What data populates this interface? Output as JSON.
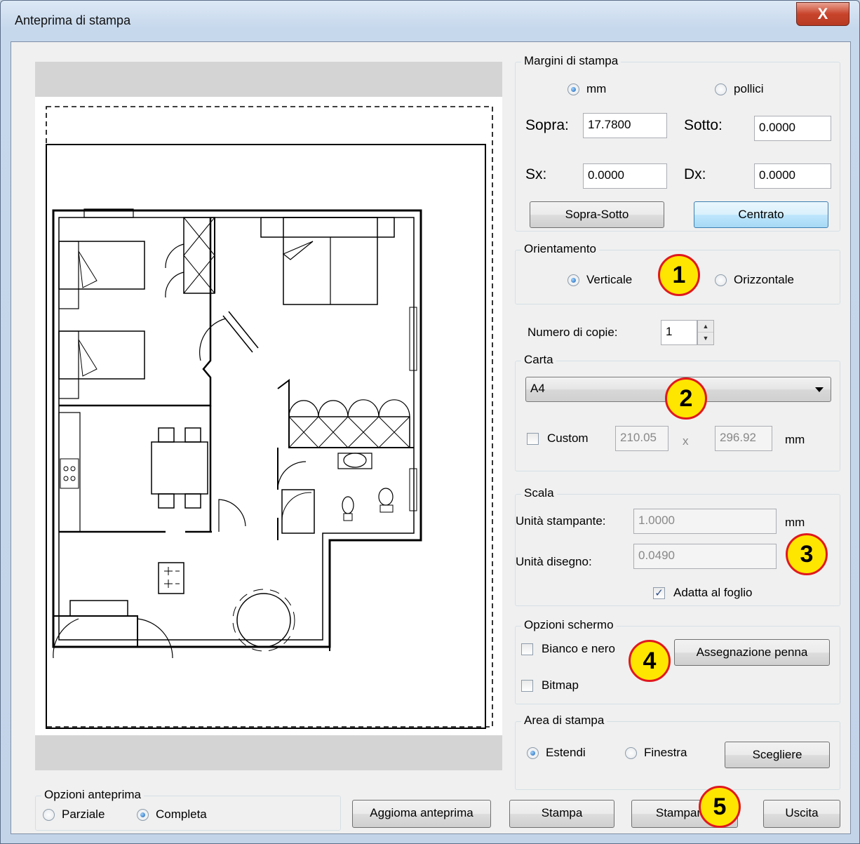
{
  "window": {
    "title": "Anteprima di stampa",
    "close_glyph": "X"
  },
  "margins": {
    "group": "Margini di stampa",
    "unit_mm": "mm",
    "unit_in": "pollici",
    "top_label": "Sopra:",
    "top_value": "17.7800",
    "bottom_label": "Sotto:",
    "bottom_value": "0.0000",
    "left_label": "Sx:",
    "left_value": "0.0000",
    "right_label": "Dx:",
    "right_value": "0.0000",
    "btn_topbottom": "Sopra-Sotto",
    "btn_center": "Centrato"
  },
  "orientation": {
    "group": "Orientamento",
    "portrait": "Verticale",
    "landscape": "Orizzontale"
  },
  "copies": {
    "label": "Numero di copie:",
    "value": "1"
  },
  "paper": {
    "group": "Carta",
    "selected": "A4",
    "custom_label": "Custom",
    "width": "210.05",
    "x": "x",
    "height": "296.92",
    "unit": "mm"
  },
  "scale": {
    "group": "Scala",
    "printer_units_label": "Unità stampante:",
    "printer_units_value": "1.0000",
    "unit": "mm",
    "drawing_units_label": "Unità disegno:",
    "drawing_units_value": "0.0490",
    "fit_label": "Adatta al foglio"
  },
  "screen": {
    "group": "Opzioni schermo",
    "bw_label": "Bianco e nero",
    "bitmap_label": "Bitmap",
    "pen_button": "Assegnazione penna"
  },
  "area": {
    "group": "Area di stampa",
    "extend": "Estendi",
    "window": "Finestra",
    "choose_button": "Scegliere"
  },
  "preview_opts": {
    "group": "Opzioni anteprima",
    "partial": "Parziale",
    "full": "Completa"
  },
  "buttons": {
    "refresh": "Aggioma anteprima",
    "print": "Stampa",
    "printer": "Stampante",
    "exit": "Uscita"
  },
  "badges": [
    "1",
    "2",
    "3",
    "4",
    "5"
  ],
  "colors": {
    "badge_fill": "#ffe600",
    "badge_border": "#e0191e",
    "accent": "#1b62b6"
  }
}
